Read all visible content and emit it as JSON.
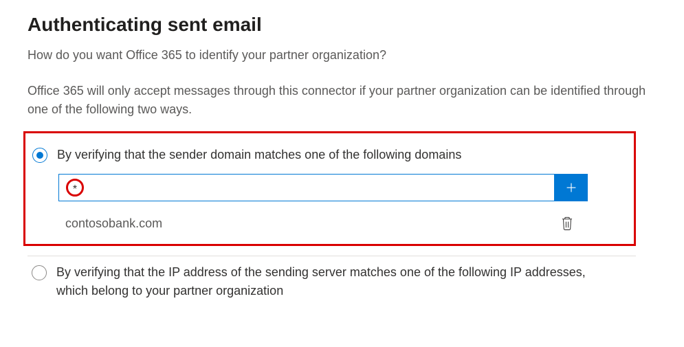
{
  "title": "Authenticating sent email",
  "subtitle": "How do you want Office 365 to identify your partner organization?",
  "description": "Office 365 will only accept messages through this connector if your partner organization can be identified through one of the following two ways.",
  "option1": {
    "label": "By verifying that the sender domain matches one of the following domains",
    "input_value": "*",
    "domains": [
      "contosobank.com"
    ]
  },
  "option2": {
    "label": "By verifying that the IP address of the sending server matches one of the following IP addresses, which belong to your partner organization"
  },
  "colors": {
    "accent": "#0078d4",
    "highlight": "#d90000"
  }
}
